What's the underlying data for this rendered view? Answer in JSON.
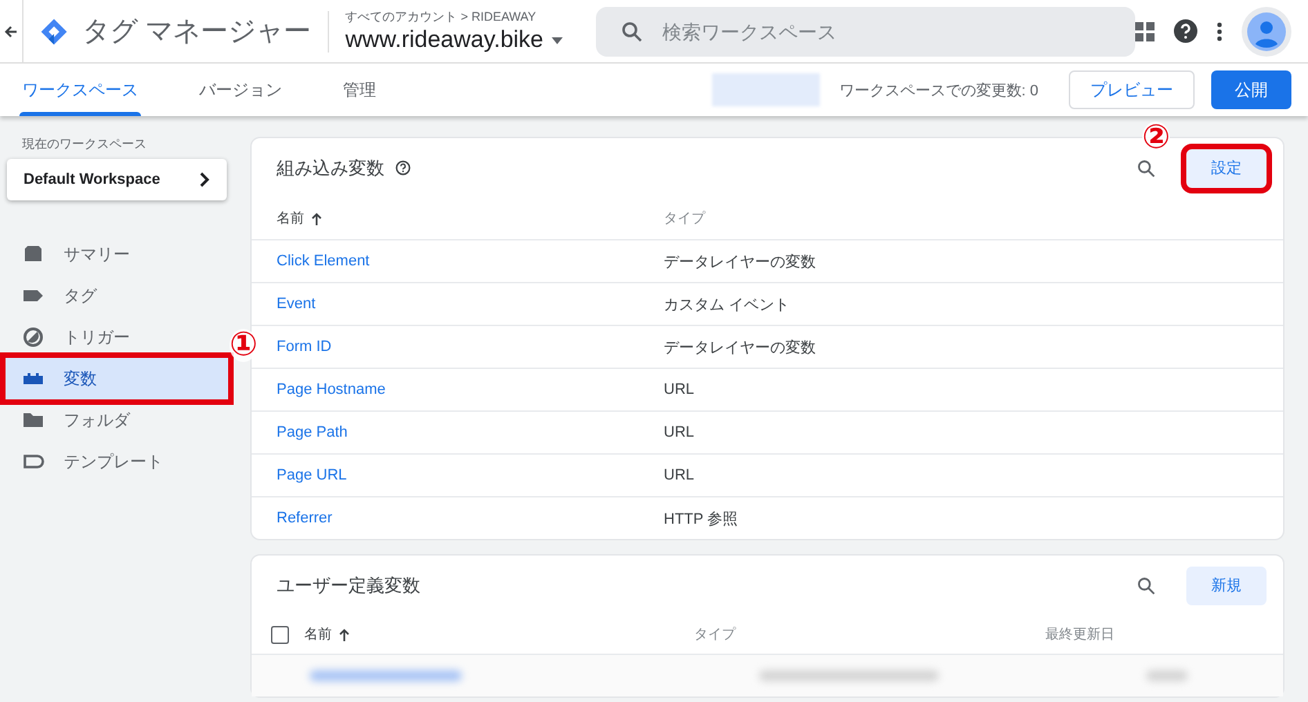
{
  "header": {
    "product": "タグ マネージャー",
    "breadcrumb": "すべてのアカウント > RIDEAWAY",
    "container": "www.rideaway.bike",
    "search": {
      "placeholder": "検索ワークスペース"
    }
  },
  "tabs": [
    {
      "label": "ワークスペース",
      "selected": true
    },
    {
      "label": "バージョン",
      "selected": false
    },
    {
      "label": "管理",
      "selected": false
    }
  ],
  "changes": "ワークスペースでの変更数: 0",
  "actions": {
    "preview": "プレビュー",
    "publish": "公開"
  },
  "sidebar": {
    "label": "現在のワークスペース",
    "workspace": "Default Workspace",
    "items": [
      {
        "kind": "summary",
        "label": "サマリー",
        "selected": false,
        "outlined": false
      },
      {
        "kind": "tag",
        "label": "タグ",
        "selected": false,
        "outlined": false
      },
      {
        "kind": "trigger",
        "label": "トリガー",
        "selected": false,
        "outlined": false
      },
      {
        "kind": "variable",
        "label": "変数",
        "selected": true,
        "outlined": true
      },
      {
        "kind": "folder",
        "label": "フォルダ",
        "selected": false,
        "outlined": false
      },
      {
        "kind": "template",
        "label": "テンプレート",
        "selected": false,
        "outlined": false
      }
    ]
  },
  "builtin": {
    "title": "組み込み変数",
    "button": {
      "label": "設定",
      "outlined": true
    },
    "columns": [
      "名前",
      "タイプ"
    ],
    "rows": [
      {
        "name": "Click Element",
        "type": "データレイヤーの変数"
      },
      {
        "name": "Event",
        "type": "カスタム イベント"
      },
      {
        "name": "Form ID",
        "type": "データレイヤーの変数"
      },
      {
        "name": "Page Hostname",
        "type": "URL"
      },
      {
        "name": "Page Path",
        "type": "URL"
      },
      {
        "name": "Page URL",
        "type": "URL"
      },
      {
        "name": "Referrer",
        "type": "HTTP 参照"
      }
    ]
  },
  "user_defined": {
    "title": "ユーザー定義変数",
    "button": {
      "label": "新規",
      "outlined": false
    },
    "select_all": {
      "checked": false
    },
    "columns": [
      "名前",
      "タイプ",
      "最終更新日"
    ]
  },
  "annotations": [
    {
      "label": "①"
    },
    {
      "label": "②"
    }
  ]
}
